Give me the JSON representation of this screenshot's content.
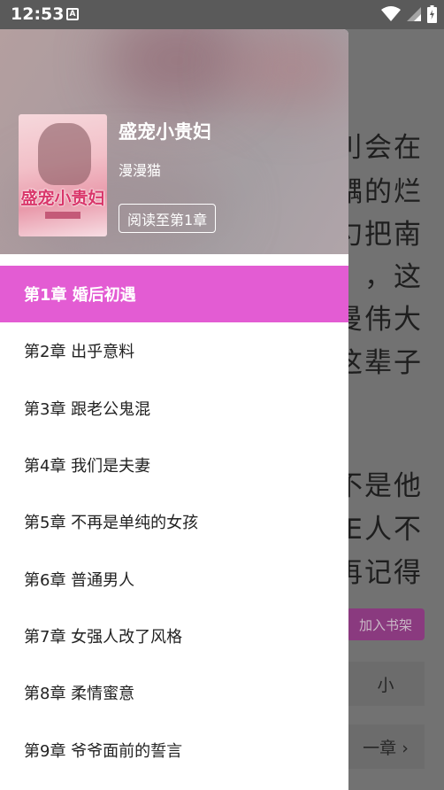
{
  "status_bar": {
    "time": "12:53",
    "notification_icon": "a-notification-icon",
    "icons": [
      "wifi-icon",
      "signal-icon",
      "battery-icon"
    ]
  },
  "reader": {
    "visible_text_fragments": [
      "刂会在",
      "髃的烂",
      "勺把南",
      "，这",
      "曼伟大",
      "这辈子",
      "不是他",
      "E人不",
      "再记得"
    ],
    "add_to_shelf_label": "加入书架",
    "font_size_label": "小",
    "next_chapter_label": "一章 ›"
  },
  "drawer": {
    "book": {
      "cover_title": "盛宠小贵妇",
      "title": "盛宠小贵妇",
      "author": "漫漫猫",
      "read_button": "阅读至第1章"
    },
    "chapters": [
      {
        "label": "第1章 婚后初遇",
        "active": true
      },
      {
        "label": "第2章 出乎意料",
        "active": false
      },
      {
        "label": "第3章 跟老公鬼混",
        "active": false
      },
      {
        "label": "第4章 我们是夫妻",
        "active": false
      },
      {
        "label": "第5章 不再是单纯的女孩",
        "active": false
      },
      {
        "label": "第6章 普通男人",
        "active": false
      },
      {
        "label": "第7章 女强人改了风格",
        "active": false
      },
      {
        "label": "第8章 柔情蜜意",
        "active": false
      },
      {
        "label": "第9章 爷爷面前的誓言",
        "active": false
      }
    ]
  },
  "colors": {
    "accent": "#e35cd3",
    "shelf_button": "#8a3a7f"
  }
}
